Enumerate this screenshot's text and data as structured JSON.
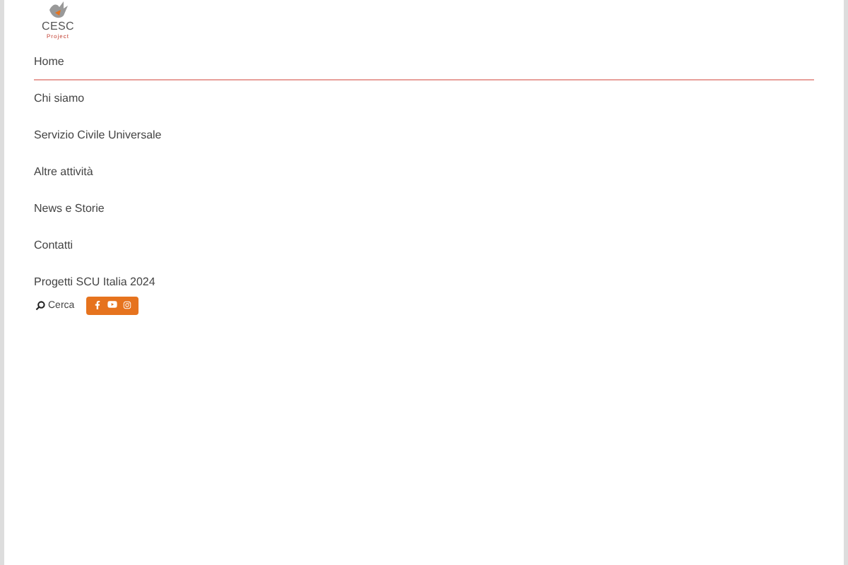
{
  "logo": {
    "title": "CESC",
    "subtitle": "Project"
  },
  "menu": [
    {
      "label": "Home",
      "selected": true
    },
    {
      "label": "Chi siamo",
      "selected": false
    },
    {
      "label": "Servizio Civile Universale",
      "selected": false
    },
    {
      "label": "Altre attività",
      "selected": false
    },
    {
      "label": "News e Storie",
      "selected": false
    },
    {
      "label": "Contatti",
      "selected": false
    },
    {
      "label": "Progetti SCU Italia 2024",
      "selected": false
    }
  ],
  "search": {
    "label": "Cerca"
  }
}
